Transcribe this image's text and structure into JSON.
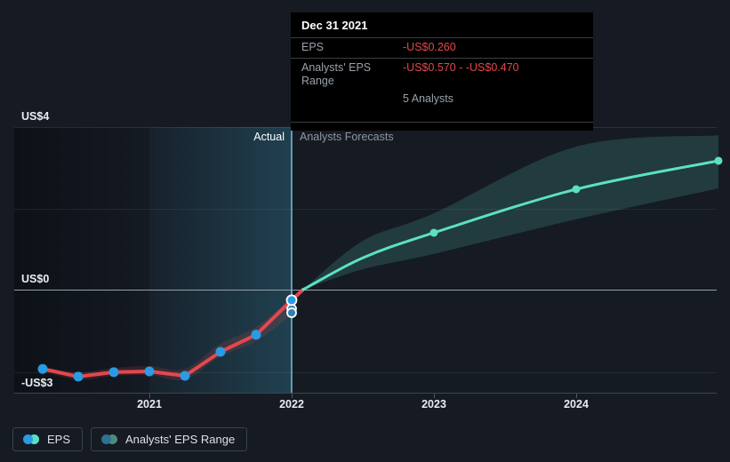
{
  "tooltip": {
    "date": "Dec 31 2021",
    "rows": [
      {
        "label": "EPS",
        "value": "-US$0.260"
      },
      {
        "label": "Analysts' EPS Range",
        "value": "-US$0.570 - -US$0.470"
      }
    ],
    "analysts": "5 Analysts"
  },
  "labels": {
    "actual": "Actual",
    "forecast": "Analysts Forecasts"
  },
  "axes": {
    "y": [
      "US$4",
      "US$0",
      "-US$3"
    ],
    "x": [
      "2021",
      "2022",
      "2023",
      "2024"
    ]
  },
  "legend": {
    "items": [
      {
        "label": "EPS",
        "dot_colors": [
          "#2a9be4",
          "#57e0c2"
        ]
      },
      {
        "label": "Analysts' EPS Range",
        "dot_colors": [
          "#2e7193",
          "#4d8b80"
        ]
      }
    ]
  },
  "colors": {
    "background": "#151a23",
    "tooltip_background": "#000000",
    "negative_value_text": "#e24848",
    "actual_line": "#e2484e",
    "actual_dot": "#2a9be4",
    "forecast_line": "#5ce0c4",
    "zero_gridline": "#96a0a8",
    "hover_range_dot": "#2f80b5"
  },
  "chart_data": {
    "type": "line",
    "title": "",
    "xlabel": "",
    "ylabel": "",
    "x_tick_labels": [
      "2021",
      "2022",
      "2023",
      "2024"
    ],
    "y_tick_labels": [
      "US$4",
      "US$0",
      "-US$3"
    ],
    "y_gridline_values": [
      4,
      2,
      0,
      -2
    ],
    "ylim": [
      -2.55,
      4.0
    ],
    "xlim": [
      2020.05,
      2025.0
    ],
    "legend_position": "bottom-left",
    "grid": true,
    "series": [
      {
        "name": "EPS (actual)",
        "line_color": "#e2484e",
        "color": "#2a9be4",
        "x": [
          2020.25,
          2020.5,
          2020.75,
          2021.0,
          2021.25,
          2021.5,
          2021.75,
          2022.0
        ],
        "values": [
          -1.95,
          -2.14,
          -2.03,
          -2.01,
          -2.12,
          -1.53,
          -1.11,
          -0.26
        ]
      },
      {
        "name": "EPS (analysts forecast)",
        "color": "#5ce0c4",
        "x": [
          2022.08,
          2022.5,
          2023.0,
          2024.0,
          2025.0
        ],
        "values": [
          0.0,
          0.78,
          1.4,
          2.47,
          3.17
        ],
        "marker_x": [
          2023.0,
          2024.0,
          2025.0
        ]
      },
      {
        "name": "Analysts' EPS Range (actual)",
        "fill": "rgba(229,72,72,0.16)",
        "x": [
          2020.25,
          2020.5,
          2020.75,
          2021.0,
          2021.25,
          2021.5,
          2021.75,
          2022.0
        ],
        "low": [
          -2.01,
          -2.22,
          -2.12,
          -2.1,
          -2.21,
          -1.64,
          -1.27,
          -0.62
        ],
        "high": [
          -1.9,
          -2.03,
          -1.93,
          -1.88,
          -1.95,
          -1.33,
          -0.92,
          -0.2
        ]
      },
      {
        "name": "Analysts' EPS Range (forecast)",
        "fill": "rgba(94,224,196,0.17)",
        "x": [
          2022.08,
          2022.5,
          2023.0,
          2024.0,
          2025.0
        ],
        "low": [
          0.0,
          0.5,
          0.88,
          1.73,
          2.49
        ],
        "high": [
          0.0,
          1.2,
          1.88,
          3.52,
          3.8
        ]
      }
    ],
    "hover_point": {
      "x": 2022.0,
      "eps": -0.26,
      "range_values": [
        -0.47,
        -0.57
      ],
      "dot_color": "#2f80b5"
    }
  }
}
